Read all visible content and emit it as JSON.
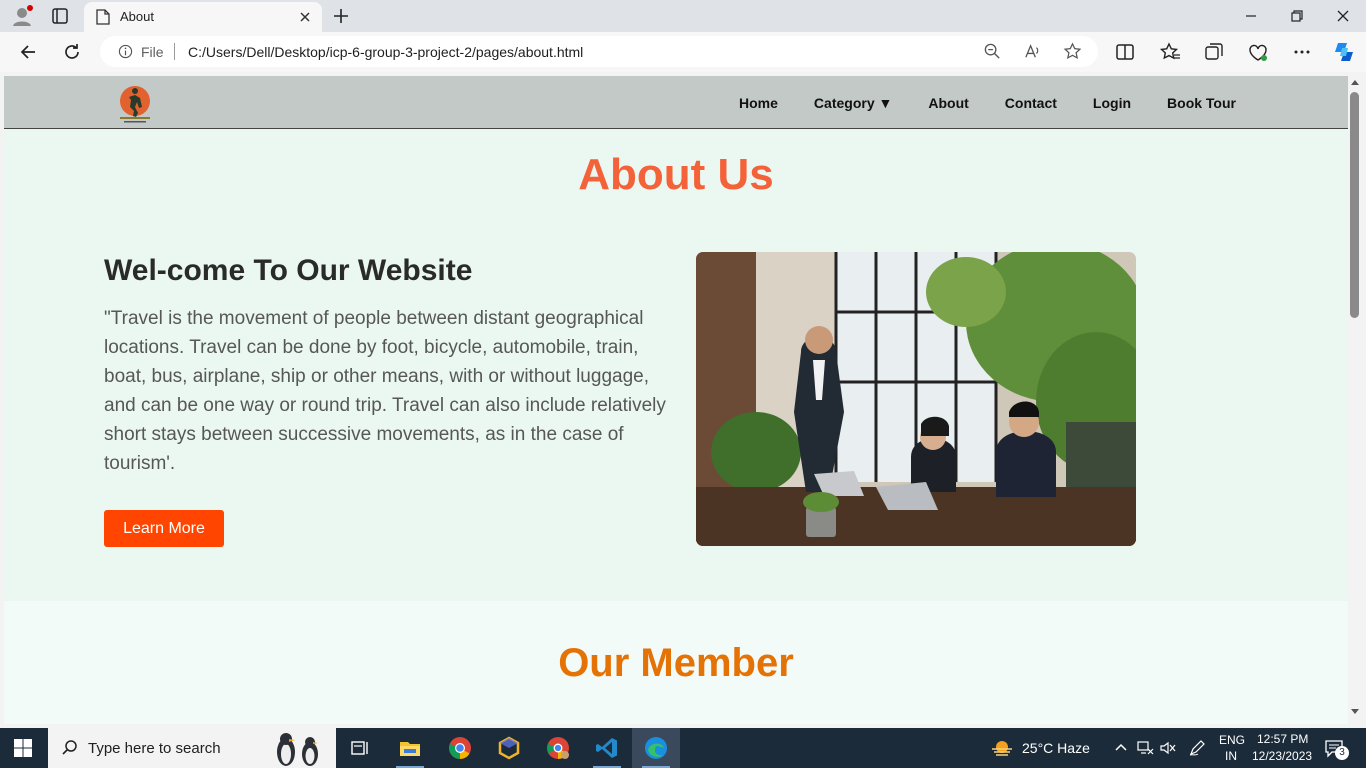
{
  "browser": {
    "tab_title": "About",
    "protocol": "File",
    "url": "C:/Users/Dell/Desktop/icp-6-group-3-project-2/pages/about.html"
  },
  "site": {
    "nav": [
      "Home",
      "Category ▼",
      "About",
      "Contact",
      "Login",
      "Book Tour"
    ],
    "page_title": "About Us",
    "welcome_heading": "Wel-come To Our Website",
    "paragraph": "\"Travel is the movement of people between distant geographical locations. Travel can be done by foot, bicycle, automobile, train, boat, bus, airplane, ship or other means, with or without luggage, and can be one way or round trip. Travel can also include relatively short stays between successive movements, as in the case of tourism'.",
    "learn_more": "Learn More",
    "members_title": "Our Member",
    "colors": {
      "title": "#f4623a",
      "button": "#ff4500",
      "members": "#e57205",
      "nav_bg": "#c3c9c6"
    }
  },
  "taskbar": {
    "search_placeholder": "Type here to search",
    "weather": "25°C  Haze",
    "lang_top": "ENG",
    "lang_bottom": "IN",
    "time": "12:57 PM",
    "date": "12/23/2023",
    "notifications": "3",
    "apps": [
      "file-explorer-icon",
      "chrome-icon",
      "hexagon-app-icon",
      "chrome-profile-icon",
      "vscode-icon",
      "edge-icon"
    ]
  }
}
